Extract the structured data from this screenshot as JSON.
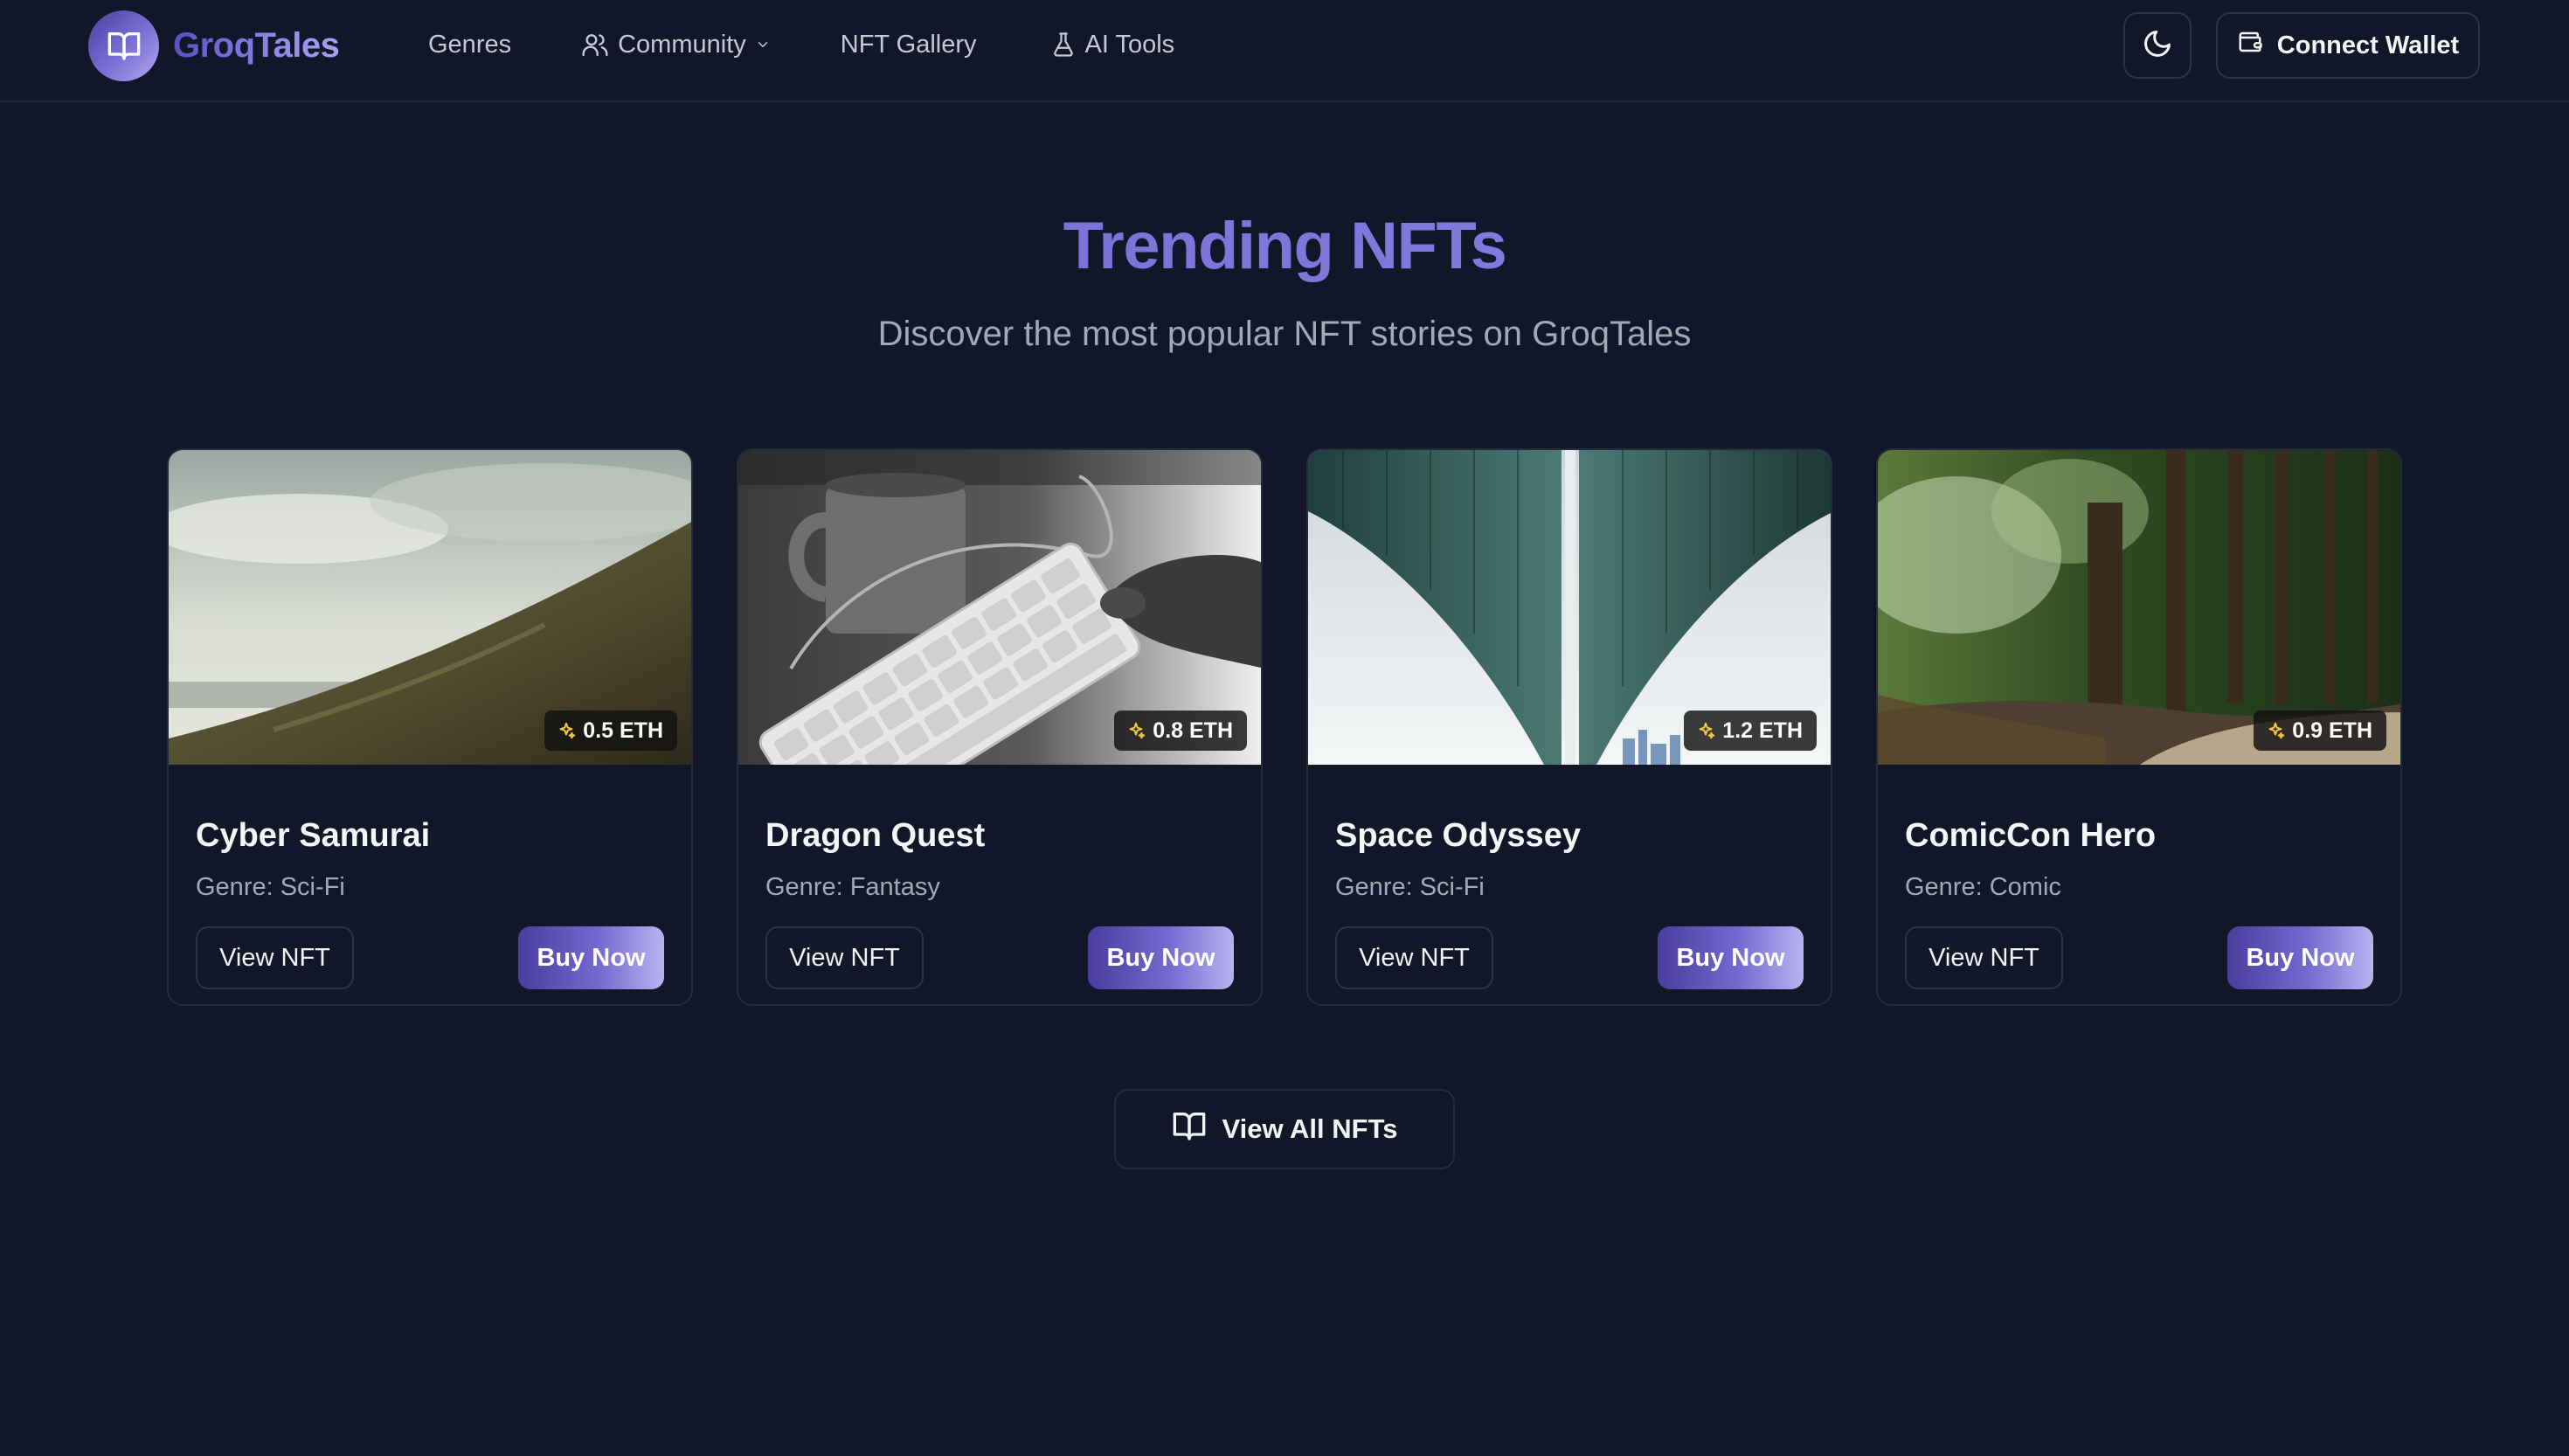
{
  "brand": {
    "name": "GroqTales",
    "logo_icon": "book-open-icon"
  },
  "nav": {
    "items": [
      {
        "label": "Genres",
        "icon": null
      },
      {
        "label": "Community",
        "icon": "users-icon",
        "has_dropdown": true
      },
      {
        "label": "NFT Gallery",
        "icon": null
      },
      {
        "label": "AI Tools",
        "icon": "flask-icon"
      }
    ]
  },
  "header_actions": {
    "theme_toggle_icon": "moon-icon",
    "wallet_label": "Connect Wallet",
    "wallet_icon": "wallet-icon"
  },
  "hero": {
    "title": "Trending NFTs",
    "subtitle": "Discover the most popular NFT stories on GroqTales"
  },
  "cards": [
    {
      "title": "Cyber Samurai",
      "genre": "Genre: Sci-Fi",
      "price": "0.5 ETH",
      "image": "hillside-landscape",
      "view_label": "View NFT",
      "buy_label": "Buy Now"
    },
    {
      "title": "Dragon Quest",
      "genre": "Genre: Fantasy",
      "price": "0.8 ETH",
      "image": "keyboard-and-mug-bw",
      "view_label": "View NFT",
      "buy_label": "Buy Now"
    },
    {
      "title": "Space Odyssey",
      "genre": "Genre: Sci-Fi",
      "price": "1.2 ETH",
      "image": "bridge-underside",
      "view_label": "View NFT",
      "buy_label": "Buy Now"
    },
    {
      "title": "ComicCon Hero",
      "genre": "Genre: Comic",
      "price": "0.9 ETH",
      "image": "forest-path",
      "view_label": "View NFT",
      "buy_label": "Buy Now"
    }
  ],
  "view_all": {
    "label": "View All NFTs",
    "icon": "book-open-icon"
  },
  "colors": {
    "background": "#111729",
    "accent_start": "#4b3d9e",
    "accent_end": "#b9b3f2",
    "title_accent": "#7468d0",
    "price_icon": "#f5c542"
  }
}
